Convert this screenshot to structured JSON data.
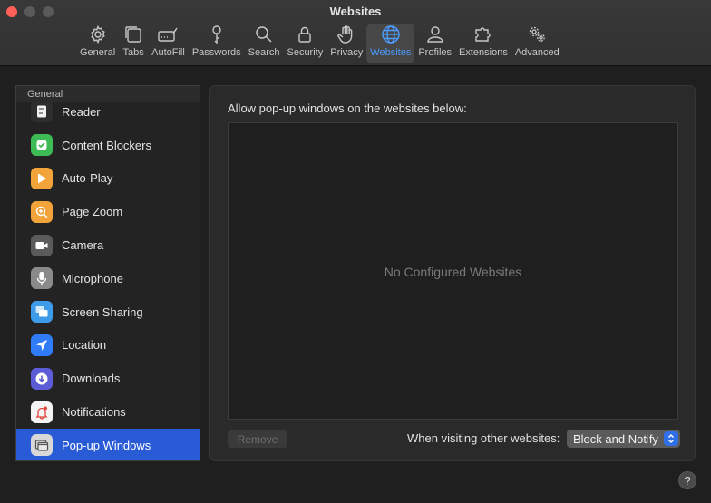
{
  "window": {
    "title": "Websites"
  },
  "toolbar": {
    "tabs": [
      {
        "label": "General",
        "icon": "gear-icon"
      },
      {
        "label": "Tabs",
        "icon": "tabs-icon"
      },
      {
        "label": "AutoFill",
        "icon": "autofill-icon"
      },
      {
        "label": "Passwords",
        "icon": "key-icon"
      },
      {
        "label": "Search",
        "icon": "search-icon"
      },
      {
        "label": "Security",
        "icon": "lock-icon"
      },
      {
        "label": "Privacy",
        "icon": "hand-icon"
      },
      {
        "label": "Websites",
        "icon": "globe-icon",
        "active": true
      },
      {
        "label": "Profiles",
        "icon": "person-icon"
      },
      {
        "label": "Extensions",
        "icon": "puzzle-icon"
      },
      {
        "label": "Advanced",
        "icon": "gears-icon"
      }
    ]
  },
  "sidebar": {
    "section": "General",
    "items": [
      {
        "label": "Reader",
        "icon": "reader-icon",
        "color": "#2e2e2e"
      },
      {
        "label": "Content Blockers",
        "icon": "checkmark-shield-icon",
        "color": "#3dbb55"
      },
      {
        "label": "Auto-Play",
        "icon": "play-icon",
        "color": "#f2a33a"
      },
      {
        "label": "Page Zoom",
        "icon": "zoom-icon",
        "color": "#f2a33a"
      },
      {
        "label": "Camera",
        "icon": "camera-icon",
        "color": "#5b5b5b"
      },
      {
        "label": "Microphone",
        "icon": "microphone-icon",
        "color": "#8a8a8a"
      },
      {
        "label": "Screen Sharing",
        "icon": "screen-sharing-icon",
        "color": "#3d9be9"
      },
      {
        "label": "Location",
        "icon": "location-arrow-icon",
        "color": "#2f7cf6"
      },
      {
        "label": "Downloads",
        "icon": "download-icon",
        "color": "#5b5cd6"
      },
      {
        "label": "Notifications",
        "icon": "bell-icon",
        "color": "#f4f4f4"
      },
      {
        "label": "Pop-up Windows",
        "icon": "popup-windows-icon",
        "color": "#d8d8d8",
        "selected": true
      }
    ]
  },
  "main": {
    "heading": "Allow pop-up windows on the websites below:",
    "empty_message": "No Configured Websites",
    "remove_label": "Remove",
    "visiting_label": "When visiting other websites:",
    "visiting_value": "Block and Notify",
    "help_label": "?"
  },
  "colors": {
    "accent": "#2a5bd6",
    "selected_tab": "#4a9cff"
  }
}
